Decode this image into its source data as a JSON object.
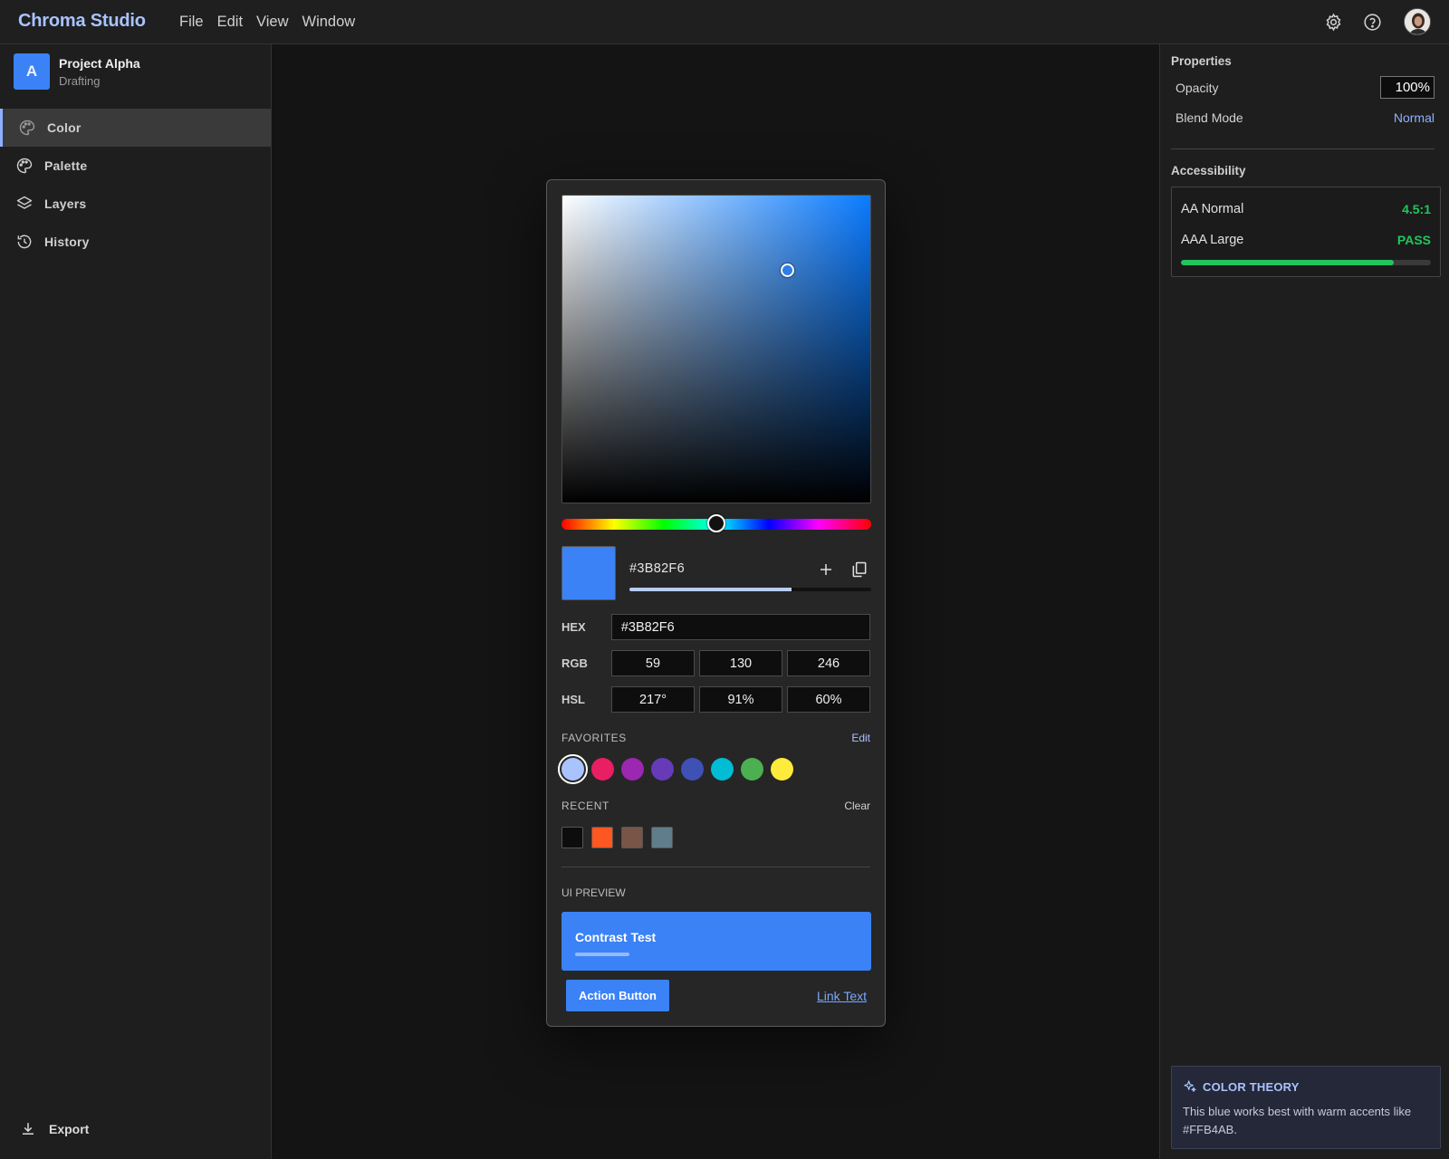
{
  "app": {
    "title": "Chroma Studio"
  },
  "menu": [
    "File",
    "Edit",
    "View",
    "Window"
  ],
  "topbar_icons": [
    "gear-icon",
    "help-icon",
    "avatar"
  ],
  "project": {
    "initial": "A",
    "name": "Project Alpha",
    "status": "Drafting"
  },
  "sidebar": {
    "items": [
      {
        "label": "Color",
        "icon": "palette-icon",
        "active": true
      },
      {
        "label": "Palette",
        "icon": "palette-icon",
        "active": false
      },
      {
        "label": "Layers",
        "icon": "layers-icon",
        "active": false
      },
      {
        "label": "History",
        "icon": "history-icon",
        "active": false
      }
    ],
    "export_label": "Export"
  },
  "picker": {
    "hex_display": "#3B82F6",
    "swatch_color": "#3B82F6",
    "alpha_level": 0.67,
    "hue_level": 0.5,
    "fields": {
      "hex_label": "HEX",
      "hex_value": "#3B82F6",
      "rgb_label": "RGB",
      "rgb": [
        "59",
        "130",
        "246"
      ],
      "hsl_label": "HSL",
      "hsl": [
        "217°",
        "91%",
        "60%"
      ]
    },
    "favorites": {
      "title": "FAVORITES",
      "action": "Edit",
      "colors": [
        "#A9C3FF",
        "#E91E63",
        "#9C27B0",
        "#673AB7",
        "#3F51B5",
        "#00BCD4",
        "#4CAF50",
        "#FFEB3B"
      ]
    },
    "recent": {
      "title": "RECENT",
      "action": "Clear",
      "colors": [
        "#0D0D0D",
        "#FF5722",
        "#795548",
        "#607D8B"
      ]
    },
    "ui_preview": {
      "title": "UI PREVIEW",
      "card_title": "Contrast Test",
      "button_label": "Action Button",
      "link_label": "Link Text"
    }
  },
  "properties": {
    "title": "Properties",
    "opacity_label": "Opacity",
    "opacity_value": "100%",
    "blend_label": "Blend Mode",
    "blend_value": "Normal"
  },
  "accessibility": {
    "title": "Accessibility",
    "rows": [
      {
        "label": "AA Normal",
        "value": "4.5:1"
      },
      {
        "label": "AAA Large",
        "value": "PASS"
      }
    ],
    "score_level": 0.85
  },
  "tip": {
    "title": "COLOR THEORY",
    "text": "This blue works best with warm accents like #FFB4AB."
  },
  "colors": {
    "accent": "#3B82F6",
    "accent_light": "#A9C3FF",
    "pass_green": "#22C55E"
  }
}
